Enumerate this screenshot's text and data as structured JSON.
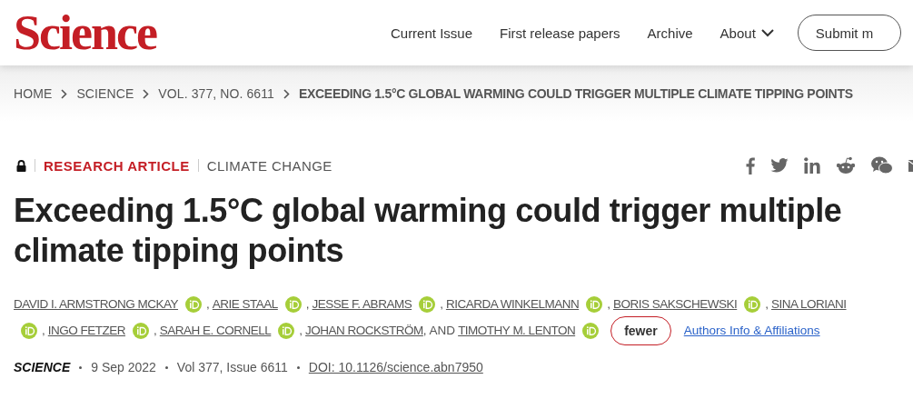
{
  "header": {
    "logo": "Science",
    "nav": [
      {
        "label": "Current Issue",
        "dropdown": false
      },
      {
        "label": "First release papers",
        "dropdown": false
      },
      {
        "label": "Archive",
        "dropdown": false
      },
      {
        "label": "About",
        "dropdown": true
      }
    ],
    "submit_button": "Submit m"
  },
  "breadcrumb": [
    "HOME",
    "SCIENCE",
    "VOL. 377, NO. 6611",
    "EXCEEDING 1.5°C GLOBAL WARMING COULD TRIGGER MULTIPLE CLIMATE TIPPING POINTS"
  ],
  "article": {
    "locked": true,
    "type": "RESEARCH ARTICLE",
    "section": "CLIMATE CHANGE",
    "share": [
      {
        "kind": "facebook"
      },
      {
        "kind": "twitter"
      },
      {
        "kind": "linkedin"
      },
      {
        "kind": "reddit"
      },
      {
        "kind": "wechat"
      },
      {
        "kind": "email"
      }
    ],
    "title": "Exceeding 1.5°C global warming could trigger multiple climate tipping points",
    "author_lines": [
      [
        {
          "name": "DAVID I. ARMSTRONG MCKAY",
          "orcid": true
        },
        {
          "sep": ",",
          "name": "ARIE STAAL",
          "orcid": true
        },
        {
          "sep": ",",
          "name": "JESSE F. ABRAMS",
          "orcid": true
        },
        {
          "sep": ",",
          "name": "RICARDA WINKELMANN",
          "orcid": true
        },
        {
          "sep": ",",
          "name": "BORIS SAKSCHEWSKI",
          "orcid": true
        },
        {
          "sep": ",",
          "name": "SINA LORIANI",
          "orcid": false
        }
      ],
      [
        {
          "orcid": true
        },
        {
          "sep": ",",
          "name": "INGO FETZER",
          "orcid": true
        },
        {
          "sep": ",",
          "name": "SARAH E. CORNELL",
          "orcid": true
        },
        {
          "sep": ",",
          "name": "JOHAN ROCKSTRÖM",
          "orcid": false
        },
        {
          "sep": ", AND",
          "name": "TIMOTHY M. LENTON",
          "orcid": true
        }
      ]
    ],
    "fewer_button": "fewer",
    "affiliations_link": "Authors Info & Affiliations",
    "journal": "SCIENCE",
    "date": "9 Sep 2022",
    "volume": "Vol 377, Issue 6611",
    "doi": "DOI: 10.1126/science.abn7950"
  }
}
